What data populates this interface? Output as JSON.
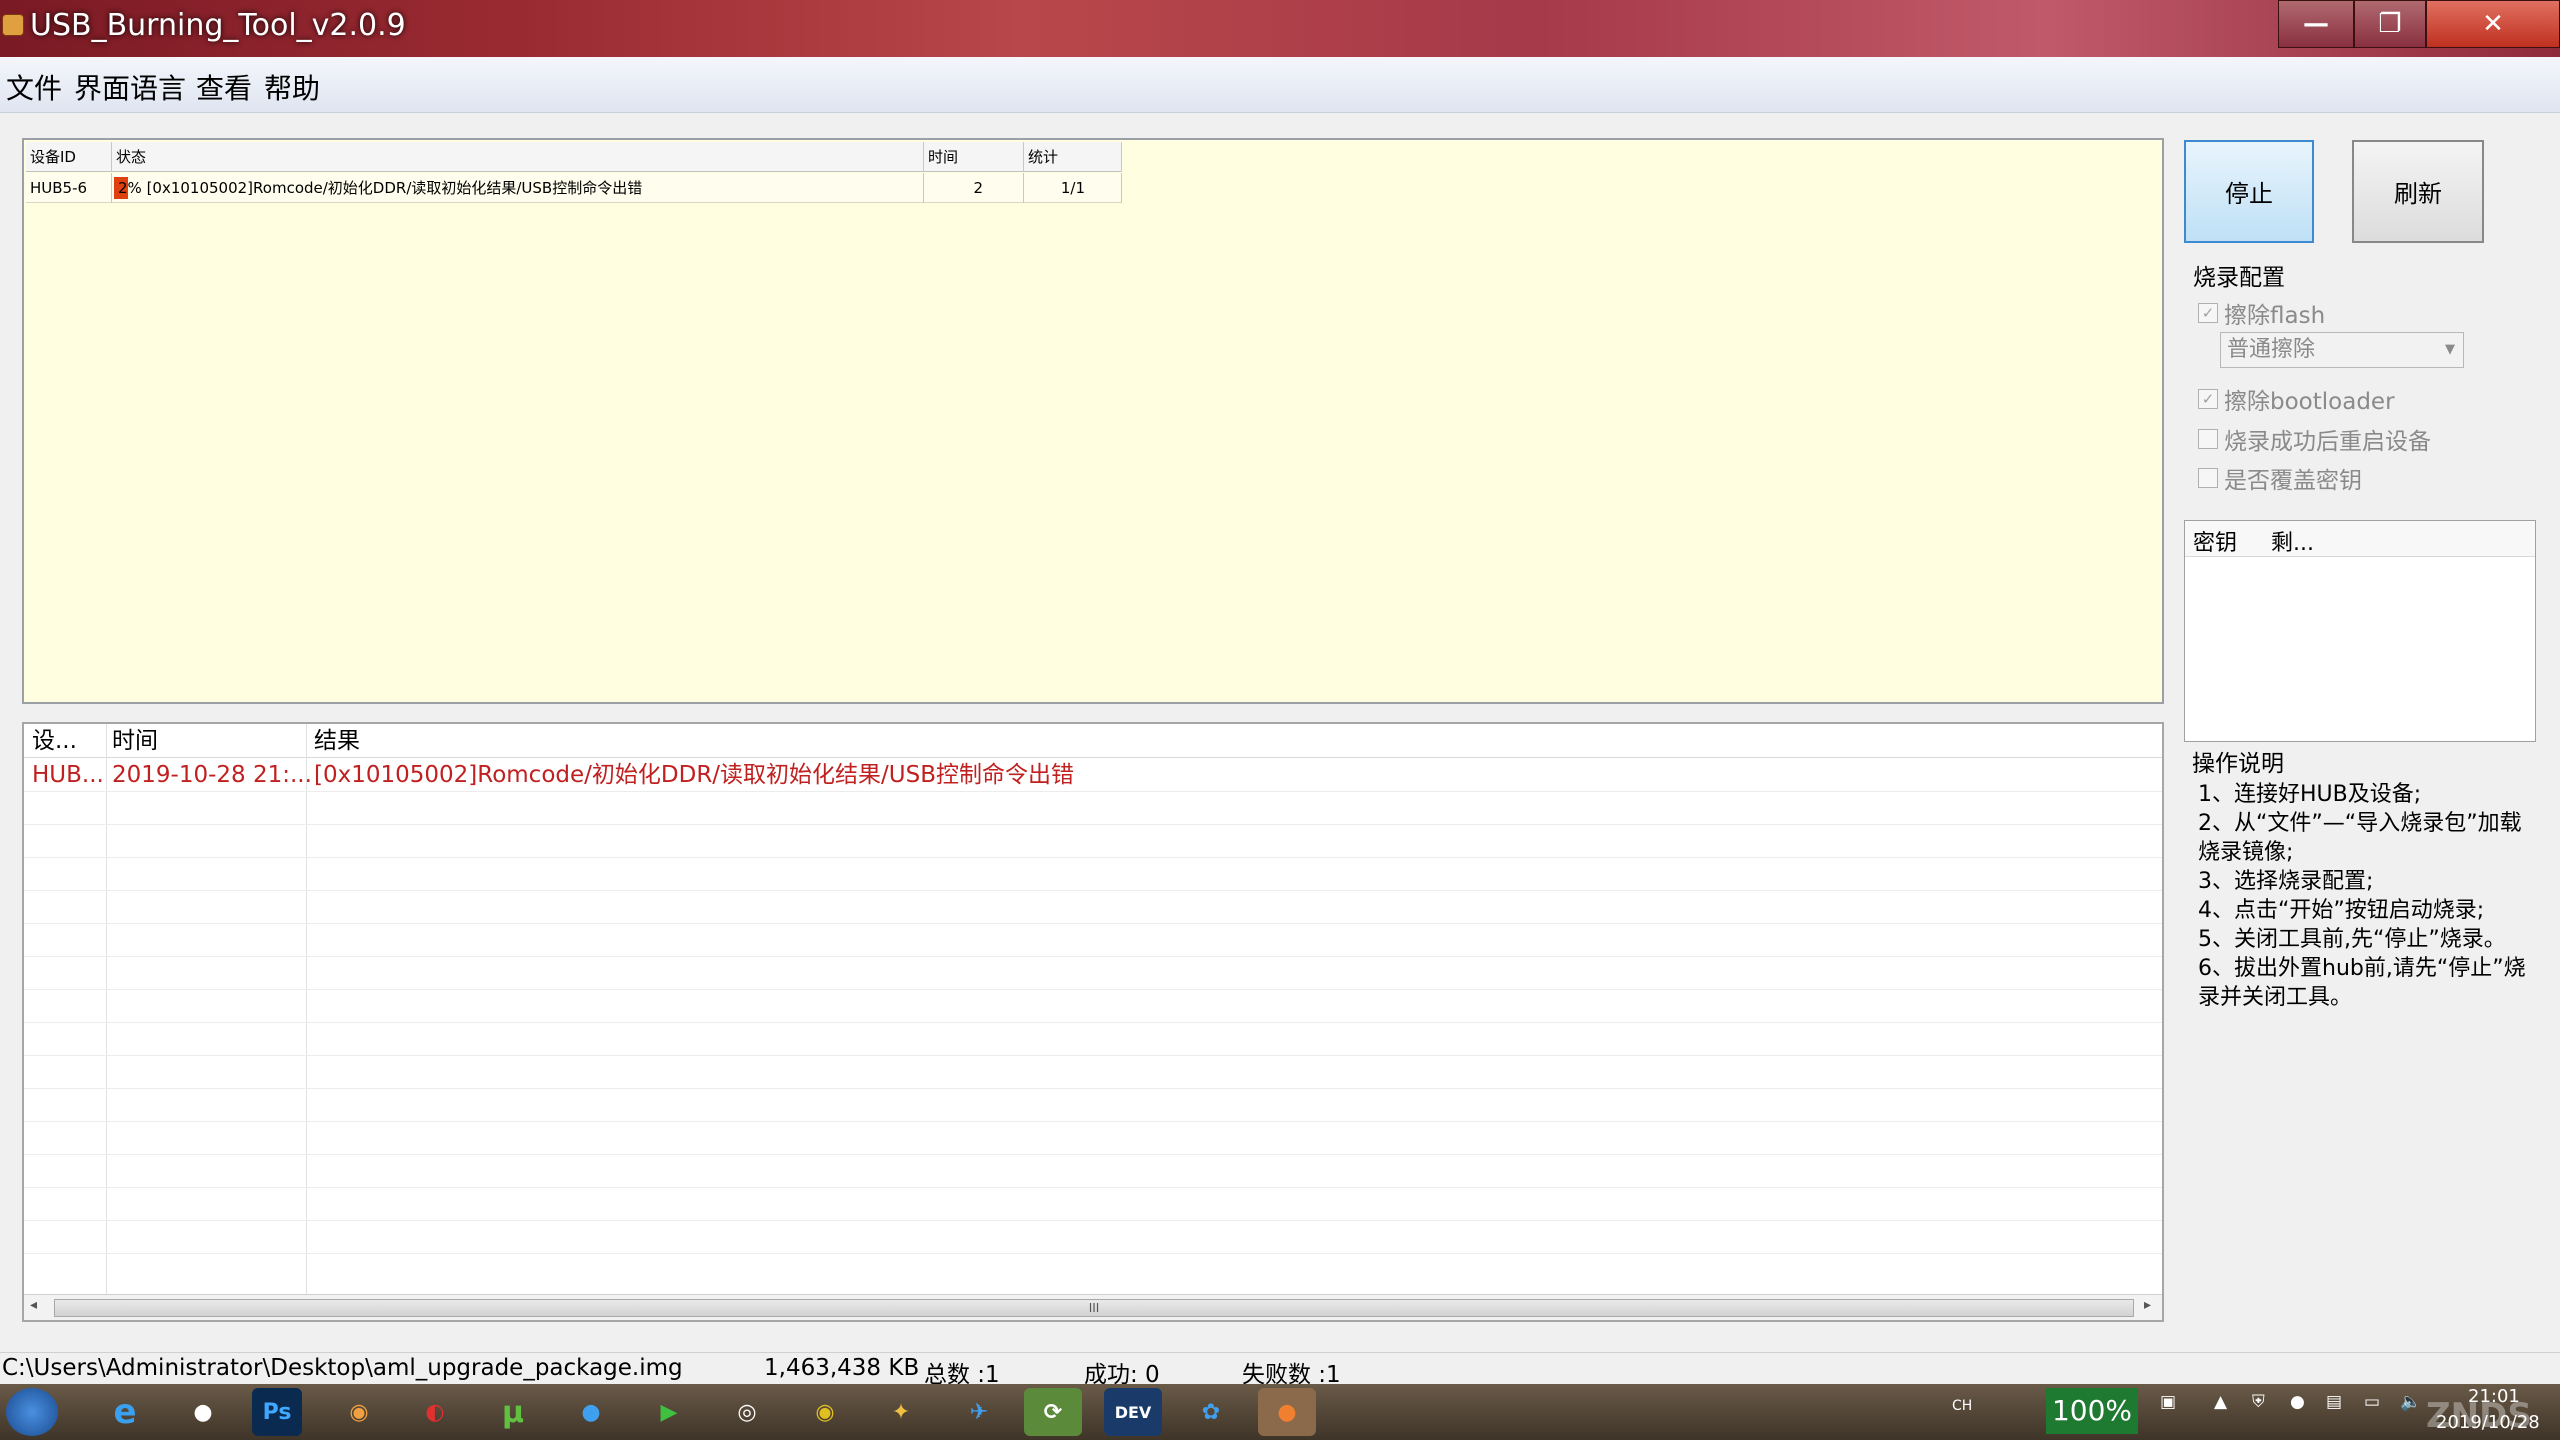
{
  "window": {
    "title": "USB_Burning_Tool_v2.0.9",
    "min": "—",
    "max": "❐",
    "close": "✕"
  },
  "menu": [
    "文件",
    "界面语言",
    "查看",
    "帮助"
  ],
  "device_table": {
    "columns": [
      "设备ID",
      "状态",
      "时间",
      "统计"
    ],
    "rows": [
      {
        "id": "HUB5-6",
        "status": "2% [0x10105002]Romcode/初始化DDR/读取初始化结果/USB控制命令出错",
        "time": "2",
        "stats": "1/1",
        "progress_percent": 2
      }
    ]
  },
  "buttons": {
    "stop": "停止",
    "refresh": "刷新"
  },
  "config": {
    "title": "烧录配置",
    "erase_flash": {
      "label": "擦除flash",
      "checked": true
    },
    "erase_mode": "普通擦除",
    "erase_bootloader": {
      "label": "擦除bootloader",
      "checked": true
    },
    "reboot_after": {
      "label": "烧录成功后重启设备",
      "checked": false
    },
    "overwrite_key": {
      "label": "是否覆盖密钥",
      "checked": false
    }
  },
  "key_list": {
    "columns": [
      "密钥",
      "剩..."
    ]
  },
  "instructions": {
    "title": "操作说明",
    "lines": [
      "1、连接好HUB及设备;",
      "2、从“文件”—“导入烧录包”加载烧录镜像;",
      "3、选择烧录配置;",
      "4、点击“开始”按钮启动烧录;",
      "5、关闭工具前,先“停止”烧录。",
      "6、拔出外置hub前,请先“停止”烧录并关闭工具。"
    ]
  },
  "log_table": {
    "columns": [
      "设...",
      "时间",
      "结果"
    ],
    "rows": [
      {
        "device": "HUB...",
        "time": "2019-10-28 21:...",
        "result": "[0x10105002]Romcode/初始化DDR/读取初始化结果/USB控制命令出错"
      }
    ],
    "scroll_thumb": "III"
  },
  "status": {
    "path": "C:\\Users\\Administrator\\Desktop\\aml_upgrade_package.img",
    "size": "1,463,438 KB",
    "total": "总数 :1",
    "success": "成功: 0",
    "fail": "失败数 :1"
  },
  "taskbar": {
    "tray_lang": "CH",
    "battery": "100%",
    "time": "21:01",
    "date": "2019/10/28",
    "watermark": "ZNDS"
  },
  "colors": {
    "error_text": "#c02020",
    "device_bg": "#fffee0"
  }
}
